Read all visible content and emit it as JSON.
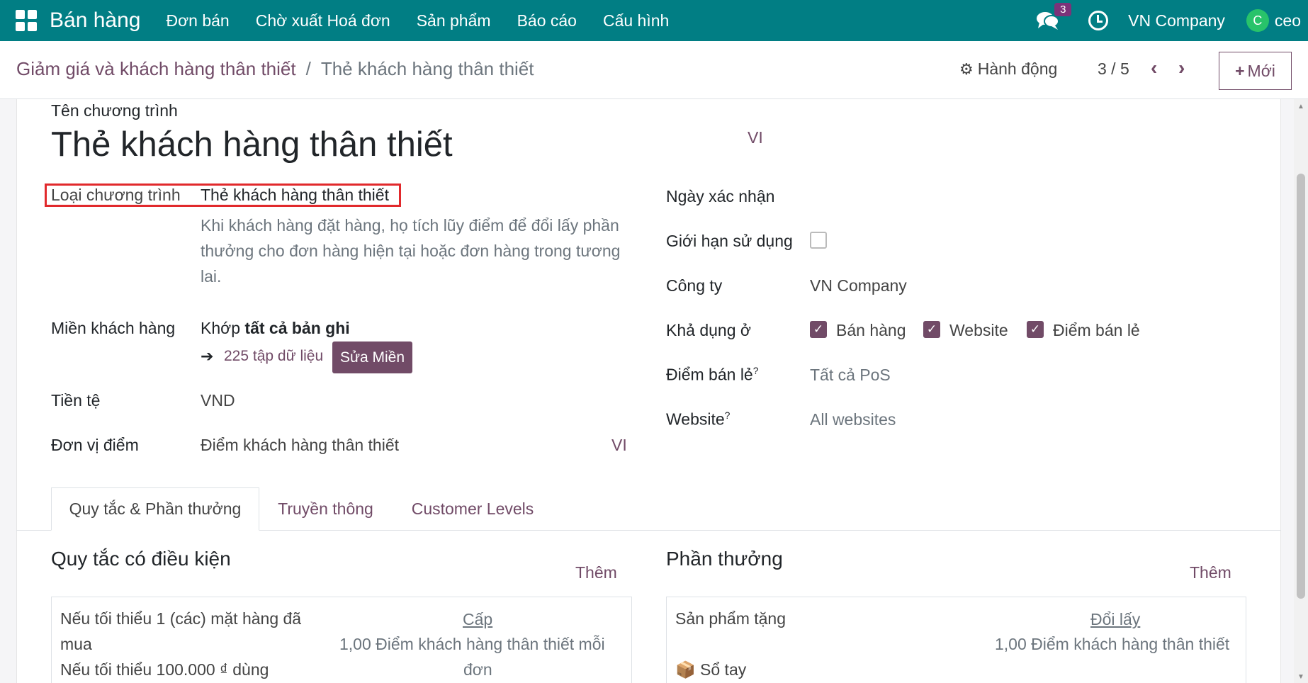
{
  "navbar": {
    "brand": "Bán hàng",
    "menu": [
      "Đơn bán",
      "Chờ xuất Hoá đơn",
      "Sản phẩm",
      "Báo cáo",
      "Cấu hình"
    ],
    "messages_count": "3",
    "company": "VN Company",
    "avatar_letter": "C",
    "user": "ceo"
  },
  "control": {
    "breadcrumb_parent": "Giảm giá và khách hàng thân thiết",
    "breadcrumb_sep": "/",
    "breadcrumb_current": "Thẻ khách hàng thân thiết",
    "action_label": "Hành động",
    "pager": "3 / 5",
    "new_label": "Mới"
  },
  "form": {
    "name_label": "Tên chương trình",
    "name_value": "Thẻ khách hàng thân thiết",
    "lang": "VI",
    "program_type_label": "Loại chương trình",
    "program_type_value": "Thẻ khách hàng thân thiết",
    "program_type_desc": "Khi khách hàng đặt hàng, họ tích lũy điểm để đổi lấy phần thưởng cho đơn hàng hiện tại hoặc đơn hàng trong tương lai.",
    "domain_label": "Miền khách hàng",
    "domain_match_prefix": "Khớp",
    "domain_match_bold": "tất cả bản ghi",
    "domain_records": "225 tập dữ liệu",
    "domain_edit_btn": "Sửa Miền",
    "currency_label": "Tiền tệ",
    "currency_value": "VND",
    "point_unit_label": "Đơn vị điểm",
    "point_unit_value": "Điểm khách hàng thân thiết",
    "point_unit_lang": "VI",
    "date_label": "Ngày xác nhận",
    "limit_label": "Giới hạn sử dụng",
    "company_label": "Công ty",
    "company_value": "VN Company",
    "available_label": "Khả dụng ở",
    "available_options": [
      "Bán hàng",
      "Website",
      "Điểm bán lẻ"
    ],
    "pos_label": "Điểm bán lẻ",
    "pos_value": "Tất cả PoS",
    "website_label": "Website",
    "website_value": "All websites",
    "help_mark": "?"
  },
  "tabs": [
    "Quy tắc & Phần thưởng",
    "Truyền thông",
    "Customer Levels"
  ],
  "rules": {
    "title": "Quy tắc có điều kiện",
    "add": "Thêm",
    "line1": "Nếu tối thiểu 1 (các) mặt hàng đã",
    "line2": "mua",
    "line3": "Nếu tối thiểu 100.000 ₫ dùng",
    "grant_link": "Cấp",
    "grant_line1": "1,00 Điểm khách hàng thân thiết mỗi",
    "grant_line2": "đơn"
  },
  "rewards": {
    "title": "Phần thưởng",
    "add": "Thêm",
    "line1": "Sản phẩm tặng",
    "product": "Sổ tay",
    "redeem_link": "Đổi lấy",
    "redeem_line1": "1,00 Điểm khách hàng thân thiết"
  },
  "colors": {
    "navbar": "#017e84",
    "accent": "#714b67",
    "highlight": "#e1292c"
  }
}
